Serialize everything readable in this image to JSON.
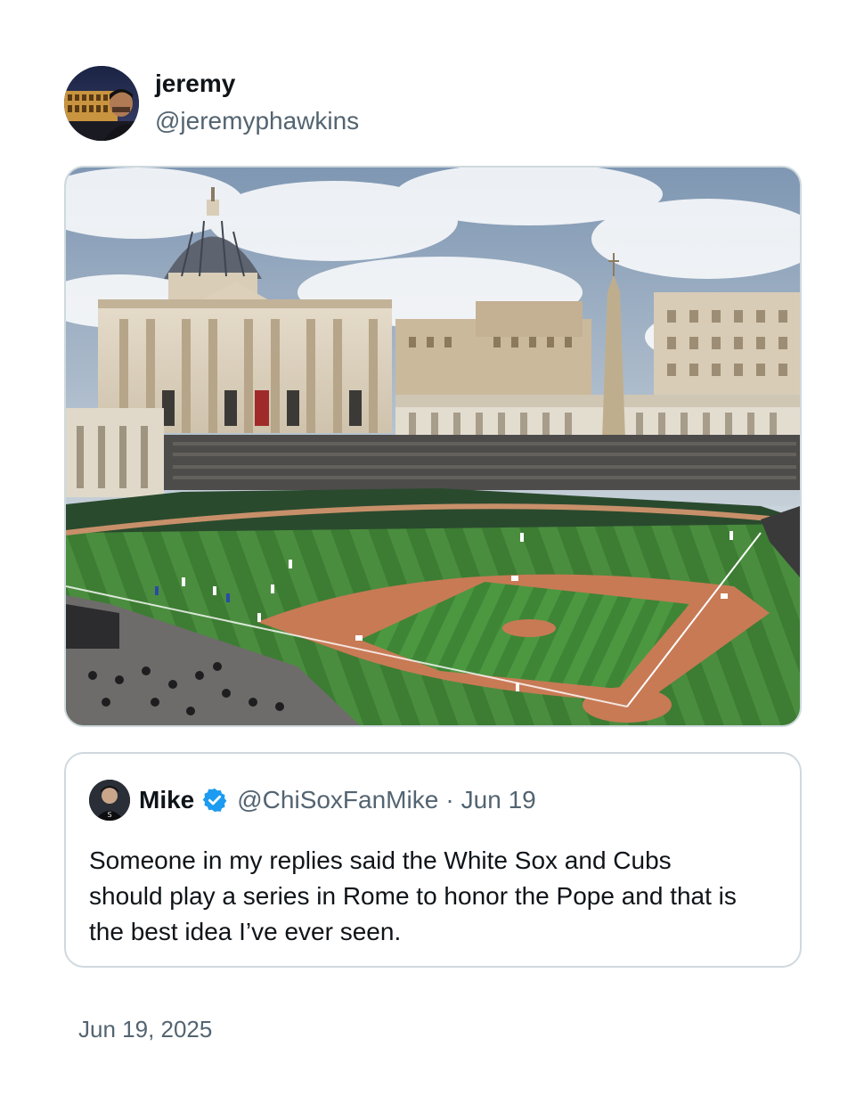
{
  "author": {
    "display_name": "jeremy",
    "handle": "@jeremyphawkins",
    "avatar_icon": "colosseum-selfie-avatar"
  },
  "media": {
    "description_icon": "vatican-baseball-field-photo"
  },
  "quote": {
    "name": "Mike",
    "verified_icon": "verified-badge-icon",
    "handle": "@ChiSoxFanMike",
    "separator": "·",
    "date": "Jun 19",
    "text": "Someone in my replies said the White Sox and Cubs should play a series in Rome to honor the Pope and that is the best idea I’ve ever seen."
  },
  "timestamp": "Jun 19, 2025",
  "colors": {
    "text_primary": "#0f1419",
    "text_secondary": "#536471",
    "border": "#cfd9de",
    "verified_blue": "#1d9bf0"
  }
}
